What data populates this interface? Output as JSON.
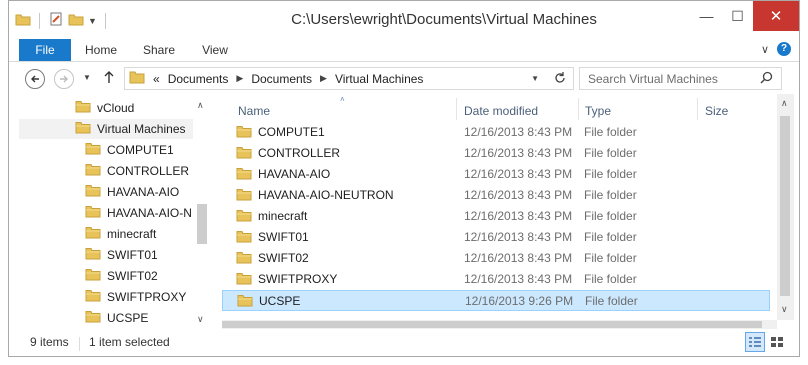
{
  "window": {
    "title": "C:\\Users\\ewright\\Documents\\Virtual Machines",
    "minimize": "—",
    "maximize": "☐",
    "close": "✕"
  },
  "ribbon": {
    "tabs": [
      "File",
      "Home",
      "Share",
      "View"
    ],
    "expand_glyph": "∨",
    "help_glyph": "?"
  },
  "address": {
    "overflow": "«",
    "breadcrumbs": [
      "Documents",
      "Documents",
      "Virtual Machines"
    ],
    "search_placeholder": "Search Virtual Machines"
  },
  "nav": {
    "items": [
      {
        "label": "vCloud",
        "indent": 0
      },
      {
        "label": "Virtual Machines",
        "indent": 0,
        "selected": true
      },
      {
        "label": "COMPUTE1",
        "indent": 1
      },
      {
        "label": "CONTROLLER",
        "indent": 1
      },
      {
        "label": "HAVANA-AIO",
        "indent": 1
      },
      {
        "label": "HAVANA-AIO-N",
        "indent": 1
      },
      {
        "label": "minecraft",
        "indent": 1
      },
      {
        "label": "SWIFT01",
        "indent": 1
      },
      {
        "label": "SWIFT02",
        "indent": 1
      },
      {
        "label": "SWIFTPROXY",
        "indent": 1
      },
      {
        "label": "UCSPE",
        "indent": 1
      }
    ]
  },
  "list": {
    "columns": [
      "Name",
      "Date modified",
      "Type",
      "Size"
    ],
    "rows": [
      {
        "name": "COMPUTE1",
        "date": "12/16/2013 8:43 PM",
        "type": "File folder"
      },
      {
        "name": "CONTROLLER",
        "date": "12/16/2013 8:43 PM",
        "type": "File folder"
      },
      {
        "name": "HAVANA-AIO",
        "date": "12/16/2013 8:43 PM",
        "type": "File folder"
      },
      {
        "name": "HAVANA-AIO-NEUTRON",
        "date": "12/16/2013 8:43 PM",
        "type": "File folder"
      },
      {
        "name": "minecraft",
        "date": "12/16/2013 8:43 PM",
        "type": "File folder"
      },
      {
        "name": "SWIFT01",
        "date": "12/16/2013 8:43 PM",
        "type": "File folder"
      },
      {
        "name": "SWIFT02",
        "date": "12/16/2013 8:43 PM",
        "type": "File folder"
      },
      {
        "name": "SWIFTPROXY",
        "date": "12/16/2013 8:43 PM",
        "type": "File folder"
      },
      {
        "name": "UCSPE",
        "date": "12/16/2013 9:26 PM",
        "type": "File folder",
        "selected": true
      }
    ]
  },
  "status": {
    "item_count": "9 items",
    "selection": "1 item selected"
  },
  "colors": {
    "file_tab": "#1979ca",
    "close_button": "#c7372f",
    "selection_bg": "#cce8ff",
    "selection_border": "#99d1ff",
    "folder": "#e8c35a"
  }
}
